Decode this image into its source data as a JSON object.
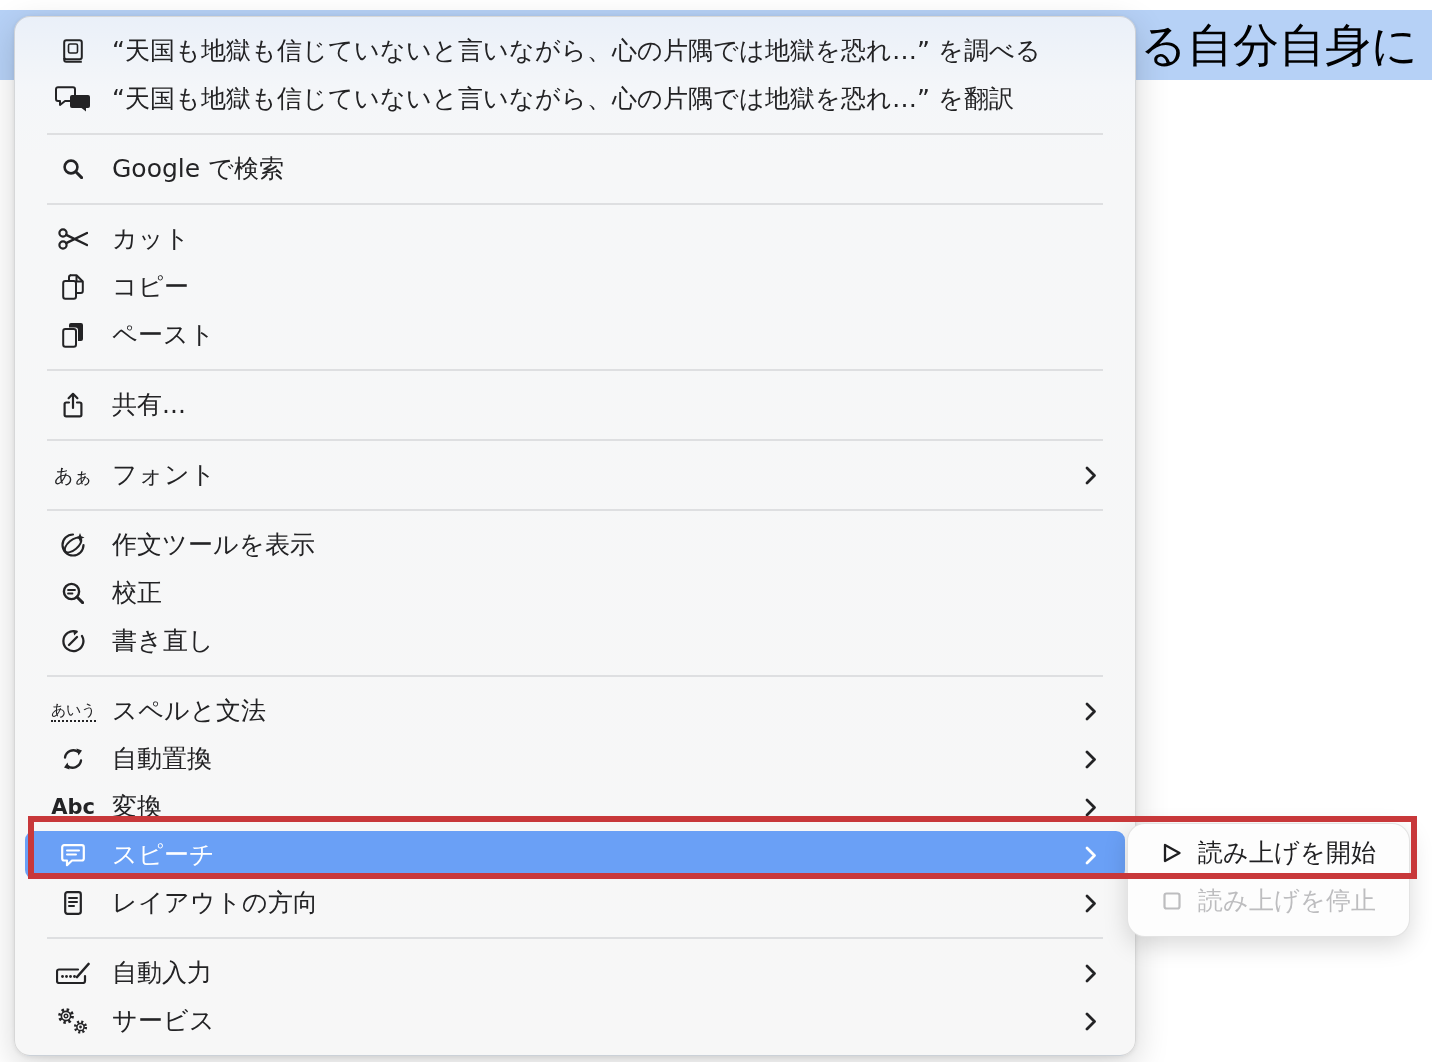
{
  "page": {
    "selected_text": "る自分自身に"
  },
  "context_menu": {
    "sections": [
      {
        "items": [
          {
            "label": "“天国も地獄も信じていないと言いながら、心の片隅では地獄を恐れ…” を調べる",
            "has_submenu": false,
            "selected": false
          },
          {
            "label": "“天国も地獄も信じていないと言いながら、心の片隅では地獄を恐れ…” を翻訳",
            "has_submenu": false,
            "selected": false
          }
        ]
      },
      {
        "items": [
          {
            "label": "Google で検索",
            "has_submenu": false,
            "selected": false
          }
        ]
      },
      {
        "items": [
          {
            "label": "カット",
            "has_submenu": false,
            "selected": false
          },
          {
            "label": "コピー",
            "has_submenu": false,
            "selected": false
          },
          {
            "label": "ペースト",
            "has_submenu": false,
            "selected": false
          }
        ]
      },
      {
        "items": [
          {
            "label": "共有...",
            "has_submenu": false,
            "selected": false
          }
        ]
      },
      {
        "items": [
          {
            "icon_text": "あぁ",
            "label": "フォント",
            "has_submenu": true,
            "selected": false
          }
        ]
      },
      {
        "items": [
          {
            "label": "作文ツールを表示",
            "has_submenu": false,
            "selected": false
          },
          {
            "label": "校正",
            "has_submenu": false,
            "selected": false
          },
          {
            "label": "書き直し",
            "has_submenu": false,
            "selected": false
          }
        ]
      },
      {
        "items": [
          {
            "icon_text": "あいう",
            "label": "スペルと文法",
            "has_submenu": true,
            "selected": false
          },
          {
            "label": "自動置換",
            "has_submenu": true,
            "selected": false
          },
          {
            "icon_text": "Abc",
            "label": "変換",
            "has_submenu": true,
            "selected": false
          },
          {
            "label": "スピーチ",
            "has_submenu": true,
            "selected": true,
            "submenu_items": [
              {
                "label": "読み上げを開始",
                "disabled": false
              },
              {
                "label": "読み上げを停止",
                "disabled": true
              }
            ]
          },
          {
            "label": "レイアウトの方向",
            "has_submenu": true,
            "selected": false
          }
        ]
      },
      {
        "items": [
          {
            "label": "自動入力",
            "has_submenu": true,
            "selected": false
          },
          {
            "label": "サービス",
            "has_submenu": true,
            "selected": false
          }
        ]
      }
    ]
  }
}
